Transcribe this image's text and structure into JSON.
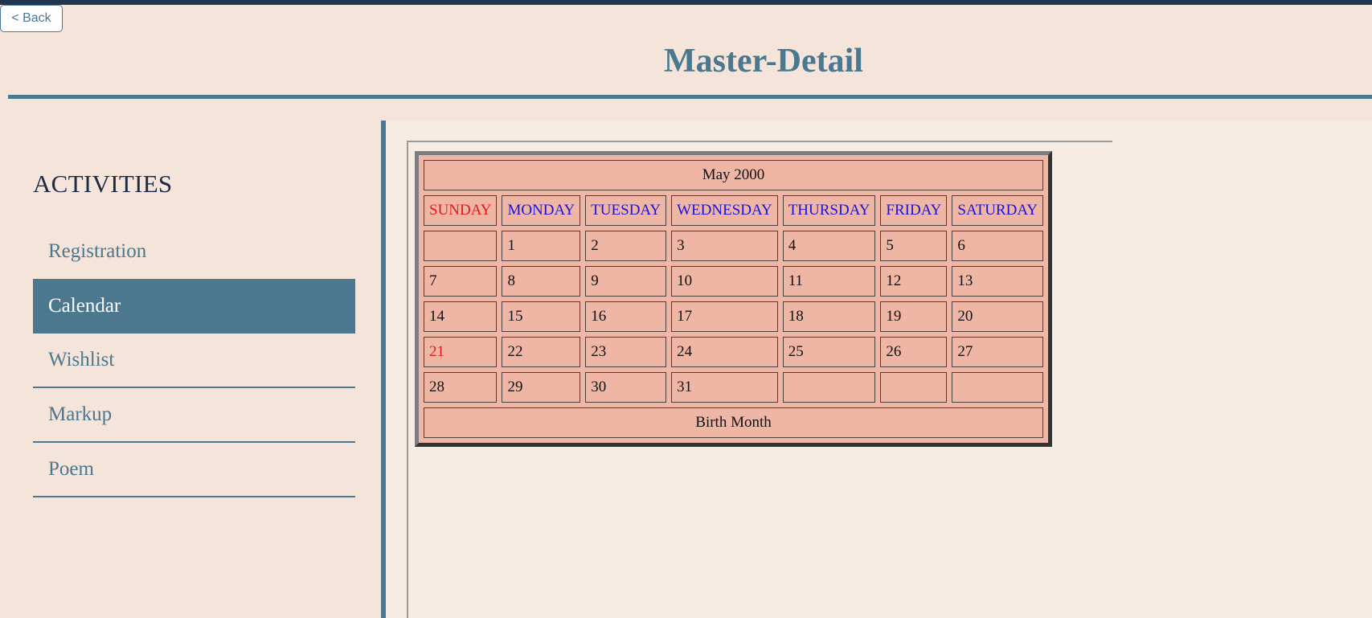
{
  "header": {
    "back_label": "< Back",
    "title": "Master-Detail"
  },
  "sidebar": {
    "heading": "ACTIVITIES",
    "items": [
      {
        "label": "Registration",
        "active": false
      },
      {
        "label": "Calendar",
        "active": true
      },
      {
        "label": "Wishlist",
        "active": false
      },
      {
        "label": "Markup",
        "active": false
      },
      {
        "label": "Poem",
        "active": false
      }
    ]
  },
  "calendar": {
    "caption": "May 2000",
    "days": [
      "SUNDAY",
      "MONDAY",
      "TUESDAY",
      "WEDNESDAY",
      "THURSDAY",
      "FRIDAY",
      "SATURDAY"
    ],
    "weeks": [
      [
        "",
        "1",
        "2",
        "3",
        "4",
        "5",
        "6"
      ],
      [
        "7",
        "8",
        "9",
        "10",
        "11",
        "12",
        "13"
      ],
      [
        "14",
        "15",
        "16",
        "17",
        "18",
        "19",
        "20"
      ],
      [
        "21",
        "22",
        "23",
        "24",
        "25",
        "26",
        "27"
      ],
      [
        "28",
        "29",
        "30",
        "31",
        "",
        "",
        ""
      ]
    ],
    "highlighted_date": "21",
    "footer": "Birth Month"
  },
  "colors": {
    "accent": "#4b788e",
    "background": "#f4e4da",
    "calendar_cell": "#efb6a5",
    "weekday_text": "#1a14d6",
    "sunday_text": "#e01a1a"
  }
}
